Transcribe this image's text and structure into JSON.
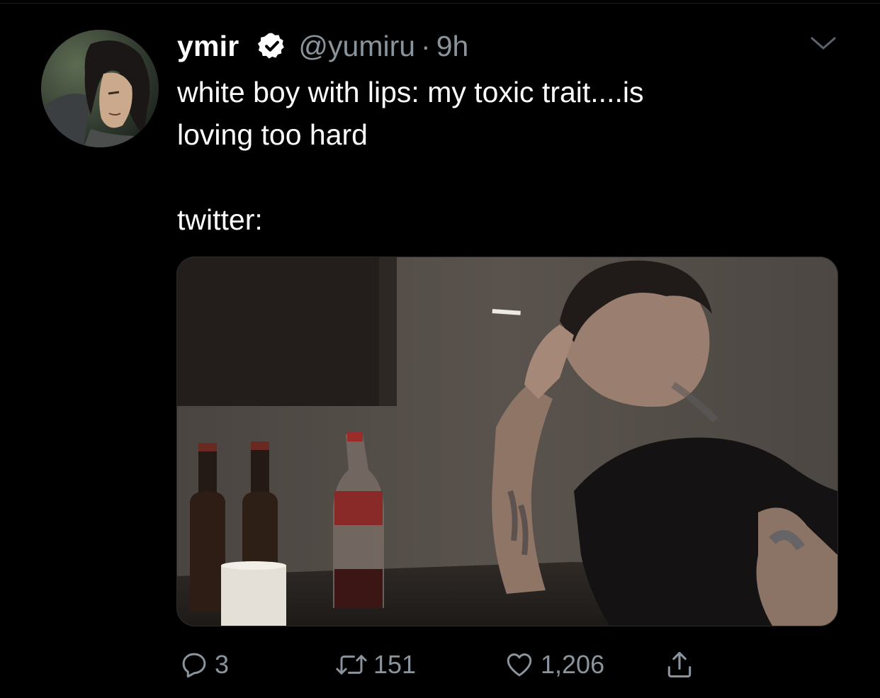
{
  "tweet": {
    "display_name": "ymir",
    "verified": true,
    "handle": "@yumiru",
    "separator": "·",
    "time": "9h",
    "text_lines": [
      "white boy with lips: my toxic trait....is",
      "loving too hard",
      "",
      "twitter:"
    ],
    "reply_count": "3",
    "retweet_count": "151",
    "like_count": "1,206"
  },
  "icons": {
    "verified": "verified-badge-icon",
    "caret": "chevron-down-icon",
    "reply": "reply-icon",
    "retweet": "retweet-icon",
    "like": "heart-icon",
    "share": "share-icon"
  },
  "colors": {
    "background": "#000000",
    "text": "#ffffff",
    "secondary": "#8a949d"
  }
}
